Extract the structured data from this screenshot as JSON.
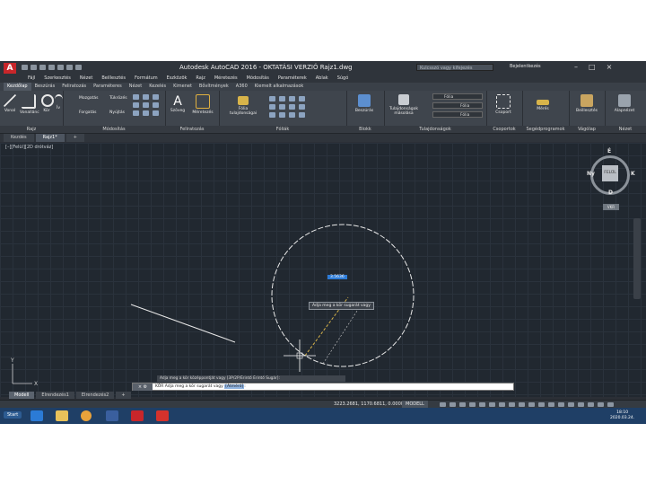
{
  "window": {
    "title": "Autodesk AutoCAD 2016 - OKTATÁSI VERZIÓ     Rajz1.dwg",
    "search_placeholder": "Kulcsszó vagy kifejezés",
    "signin": "Bejelentkezés",
    "controls": [
      "–",
      "□",
      "×"
    ]
  },
  "menu": [
    "Fájl",
    "Szerkesztés",
    "Nézet",
    "Beillesztés",
    "Formátum",
    "Eszközök",
    "Rajz",
    "Méretezés",
    "Módosítás",
    "Paraméterek",
    "Ablak",
    "Súgó"
  ],
  "ribbon_tabs": [
    "Kezdőlap",
    "Beszúrás",
    "Feliratozás",
    "Paraméteres",
    "Nézet",
    "Kezelés",
    "Kimenet",
    "Bővítmények",
    "A360",
    "Kiemelt alkalmazások"
  ],
  "ribbon": {
    "draw_tools": [
      "Vonal",
      "Vonallánc",
      "Kör",
      "Ív"
    ],
    "draw_label": "Rajz",
    "modify_tools": [
      "Mozgatás",
      "Forgatás",
      "Tükrözés",
      "Nyújtás"
    ],
    "modify_label": "Módosítás",
    "annotation_tools": [
      "Szöveg",
      "Méretezés"
    ],
    "annotation_label": "Feliratozás",
    "layer_tools": [
      "Fólia tulajdonságai"
    ],
    "layer_label": "Fóliák",
    "block_tools": [
      "Beszúrás"
    ],
    "block_label": "Blokk",
    "property_tools": [
      "Tulajdonságok másolása"
    ],
    "property_label": "Tulajdonságok",
    "layer_dropdowns": [
      "Fólia",
      "Fólia",
      "Fólia"
    ],
    "group_tools": [
      "Csoport"
    ],
    "group_label": "Csoportok",
    "utility_tools": [
      "Mérés"
    ],
    "utility_label": "Segédprogramok",
    "clipboard_tools": [
      "Beillesztés"
    ],
    "clipboard_label": "Vágólap",
    "view_tools": [
      "Alapnézet"
    ],
    "view_label": "Nézet"
  },
  "doc_tabs": [
    "Kezdés",
    "Rajz1*"
  ],
  "drawing": {
    "view_label": "[–][Felül][2D drótváz]",
    "viewcube": {
      "face": "FELÜL",
      "north": "É",
      "south": "D",
      "west": "Ny",
      "east": "K",
      "wcs": "VKR"
    },
    "dynamic_input": "3.5636",
    "tooltip": "Adja meg a kör sugarát vagy"
  },
  "command": {
    "history": "Adja meg a kör középpontját vagy [3P/2P/Érintő Érintő Sugár]:",
    "current": "KÖR Adja meg a kör sugarát vagy",
    "option": "[Átmérő]"
  },
  "layout_tabs": [
    "Modell",
    "Elrendezés1",
    "Elrendezés2"
  ],
  "status": {
    "coords": "3223.2681, 1170.6811, 0.0000",
    "mode": "MODELL"
  },
  "taskbar": {
    "start": "Start",
    "time": "18:10",
    "date": "2020.03.24."
  }
}
